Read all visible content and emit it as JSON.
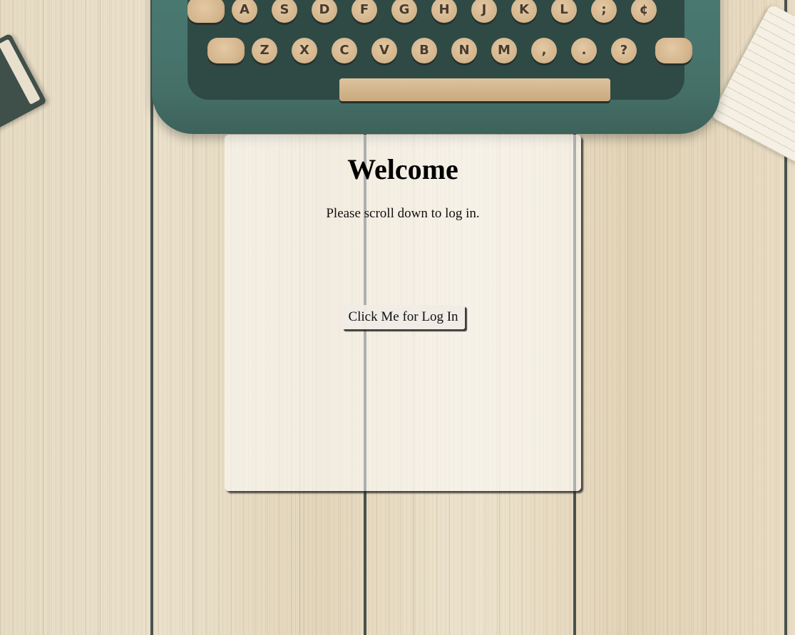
{
  "card": {
    "title": "Welcome",
    "message": "Please scroll down to log in.",
    "login_button_label": "Click Me for Log In"
  },
  "typewriter": {
    "row_top": [
      "A",
      "S",
      "D",
      "F",
      "G",
      "H",
      "J",
      "K",
      "L",
      ";",
      "¢"
    ],
    "row_bottom": [
      "Z",
      "X",
      "C",
      "V",
      "B",
      "N",
      "M",
      ",",
      ".",
      "?"
    ]
  },
  "colors": {
    "card_background": "rgba(255,255,255,0.55)",
    "typewriter_body": "#4a7a72",
    "key_cap": "#d3b48b",
    "plank_gap": "#2c3a38"
  }
}
